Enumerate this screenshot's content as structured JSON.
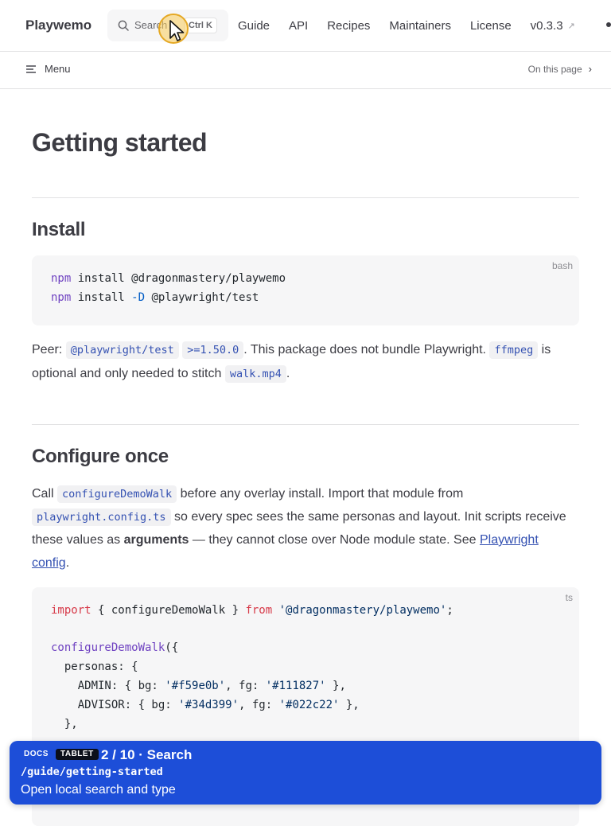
{
  "nav": {
    "brand": "Playwemo",
    "search": {
      "label": "Search",
      "shortcut": "Ctrl K"
    },
    "links": [
      "Guide",
      "API",
      "Recipes",
      "Maintainers",
      "License"
    ],
    "version": "v0.3.3",
    "external_icon": "↗"
  },
  "localnav": {
    "menu_label": "Menu",
    "on_this_page": "On this page",
    "chevron": "›"
  },
  "page": {
    "title": "Getting started",
    "install": {
      "heading": "Install",
      "lang": "bash",
      "lines": [
        [
          "npm",
          " install @dragonmastery/playwemo"
        ],
        [
          "npm",
          " install ",
          "-D",
          " @playwright/test"
        ]
      ],
      "peer_prefix": "Peer: ",
      "peer_pkg": "@playwright/test",
      "peer_ver": ">=1.50.0",
      "peer_text1": ". This package does not bundle Playwright. ",
      "ffmpeg": "ffmpeg",
      "peer_text2": " is optional and only needed to stitch ",
      "walk": "walk.mp4",
      "peer_text3": "."
    },
    "configure": {
      "heading": "Configure once",
      "p_call": "Call ",
      "p_fn": "configureDemoWalk",
      "p_t1": " before any overlay install. Import that module from ",
      "p_file": "playwright.config.ts",
      "p_t2": " so every spec sees the same personas and layout. Init scripts receive these values as ",
      "p_bold": "arguments",
      "p_t3": " — they cannot close over Node module state. See ",
      "p_link": "Playwright config",
      "p_t4": ".",
      "lang": "ts",
      "code": {
        "l1_kw": "import",
        "l1_mid": " { configureDemoWalk } ",
        "l1_from": "from",
        "l1_str": " '@dragonmastery/playwemo'",
        "l1_end": ";",
        "l3_fn": "configureDemoWalk",
        "l3_end": "({",
        "l4": "  personas: {",
        "l5_a": "    ADMIN: { bg: ",
        "l5_s1": "'#f59e0b'",
        "l5_b": ", fg: ",
        "l5_s2": "'#111827'",
        "l5_c": " },",
        "l6_a": "    ADVISOR: { bg: ",
        "l6_s1": "'#34d399'",
        "l6_b": ", fg: ",
        "l6_s2": "'#022c22'",
        "l6_c": " },",
        "l7": "  },"
      }
    }
  },
  "banner": {
    "tag1": "DOCS",
    "tag2": "TABLET",
    "step": "2 / 10 · Search",
    "route": "/guide/getting-started",
    "hint": "Open local search and type"
  },
  "colors": {
    "accent": "#3451b2",
    "banner_bg": "#1d4ed8",
    "cursor": "#e5a823"
  }
}
